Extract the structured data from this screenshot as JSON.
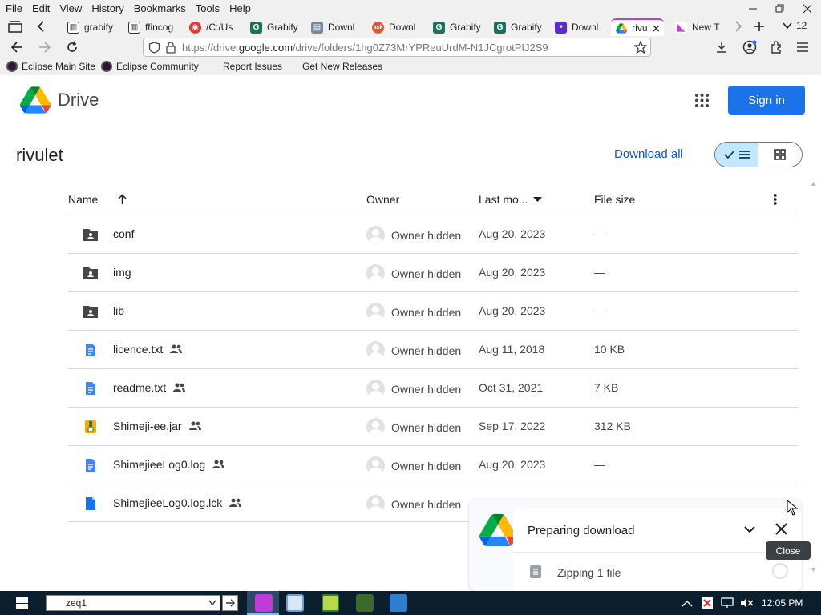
{
  "menu": [
    "File",
    "Edit",
    "View",
    "History",
    "Bookmarks",
    "Tools",
    "Help"
  ],
  "tabs": [
    {
      "label": "grabify",
      "icon": "building-icon",
      "color": "#333333"
    },
    {
      "label": "ffincog",
      "icon": "building-icon",
      "color": "#333333"
    },
    {
      "label": "/C:/Us",
      "icon": "red-disc-icon",
      "color": "#e53935"
    },
    {
      "label": "Grabify",
      "icon": "grabify-g-icon",
      "color": "#1f6f5c"
    },
    {
      "label": "Downl",
      "icon": "page-icon",
      "color": "#7a8699"
    },
    {
      "label": "Downl",
      "icon": "ask-icon",
      "color": "#e8542a"
    },
    {
      "label": "Grabify",
      "icon": "grabify-g-icon",
      "color": "#1f6f5c"
    },
    {
      "label": "Grabify",
      "icon": "grabify-g-icon",
      "color": "#1f6f5c"
    },
    {
      "label": "Downl",
      "icon": "purple-box-icon",
      "color": "#5b2bd1"
    },
    {
      "label": "rivu",
      "icon": "drive-icon",
      "color": "#1a73e8"
    },
    {
      "label": "New T",
      "icon": "fox-icon",
      "color": "#c13bd8"
    }
  ],
  "tab_count": "12",
  "url": {
    "prefix": "https://drive.",
    "domain": "google.com",
    "suffix": "/drive/folders/1hg0Z73MrYPReuUrdM-N1JCgrotPIJ2S9"
  },
  "bookmarks": [
    "Eclipse Main Site",
    "Eclipse Community",
    "Report Issues",
    "Get New Releases"
  ],
  "drive": {
    "brand": "Drive",
    "sign_in": "Sign in",
    "folder_name": "rivulet",
    "download_all": "Download all"
  },
  "table": {
    "headers": {
      "name": "Name",
      "owner": "Owner",
      "modified": "Last mo...",
      "size": "File size"
    },
    "rows": [
      {
        "name": "conf",
        "type": "folder",
        "shared": false,
        "owner": "Owner hidden",
        "modified": "Aug 20, 2023",
        "size": "—"
      },
      {
        "name": "img",
        "type": "folder",
        "shared": false,
        "owner": "Owner hidden",
        "modified": "Aug 20, 2023",
        "size": "—"
      },
      {
        "name": "lib",
        "type": "folder",
        "shared": false,
        "owner": "Owner hidden",
        "modified": "Aug 20, 2023",
        "size": "—"
      },
      {
        "name": "licence.txt",
        "type": "doc",
        "shared": true,
        "owner": "Owner hidden",
        "modified": "Aug 11, 2018",
        "size": "10 KB"
      },
      {
        "name": "readme.txt",
        "type": "doc",
        "shared": true,
        "owner": "Owner hidden",
        "modified": "Oct 31, 2021",
        "size": "7 KB"
      },
      {
        "name": "Shimeji-ee.jar",
        "type": "archive",
        "shared": true,
        "owner": "Owner hidden",
        "modified": "Sep 17, 2022",
        "size": "312 KB"
      },
      {
        "name": "ShimejieeLog0.log",
        "type": "doc",
        "shared": true,
        "owner": "Owner hidden",
        "modified": "Aug 20, 2023",
        "size": "—"
      },
      {
        "name": "ShimejieeLog0.log.lck",
        "type": "file",
        "shared": true,
        "owner": "Owner hidden",
        "modified": "",
        "size": ""
      }
    ]
  },
  "download_panel": {
    "title": "Preparing download",
    "item": "Zipping 1 file",
    "tooltip": "Close"
  },
  "taskbar": {
    "search_value": "zeq1",
    "clock": "12:05 PM"
  },
  "colors": {
    "primary": "#1a73e8",
    "link": "#0b57d0",
    "toggle_on": "#c2e7ff",
    "taskbar": "#0a1e2e"
  }
}
